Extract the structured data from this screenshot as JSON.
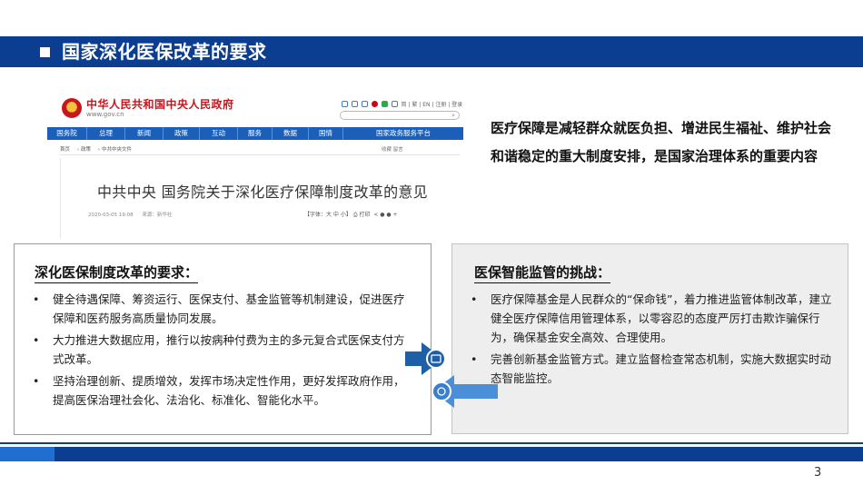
{
  "slide": {
    "title": "国家深化医保改革的要求",
    "page_number": "3"
  },
  "gov_site": {
    "logo_name": "中华人民共和国中央人民政府",
    "logo_url": "www.gov.cn",
    "utility_links": "简 | 繁 | EN | 注册 | 登录",
    "nav": [
      "国务院",
      "总理",
      "新闻",
      "政策",
      "互动",
      "服务",
      "数据",
      "国情",
      "国家政务服务平台"
    ],
    "breadcrumb": [
      "首页",
      "政策",
      "中共中央文件"
    ],
    "tools": "收藏   留言",
    "article_title": "中共中央 国务院关于深化医疗保障制度改革的意见",
    "date": "2020-03-05 19:08",
    "source": "来源：新华社",
    "font_size_control": "【字体：大 中 小】",
    "print_label": "打印"
  },
  "intro": {
    "text": "医疗保障是减轻群众就医负担、增进民生福祉、维护社会和谐稳定的重大制度安排，是国家治理体系的重要内容"
  },
  "left_box": {
    "heading": "深化医保制度改革的要求：",
    "bullets": [
      "健全待遇保障、筹资运行、医保支付、基金监管等机制建设，促进医疗保障和医药服务高质量协同发展。",
      "大力推进大数据应用，推行以按病种付费为主的多元复合式医保支付方式改革。",
      "坚持治理创新、提质增效，发挥市场决定性作用，更好发挥政府作用，提高医保治理社会化、法治化、标准化、智能化水平。"
    ]
  },
  "right_box": {
    "heading": "医保智能监管的挑战：",
    "bullets": [
      "医疗保障基金是人民群众的“保命钱”，着力推进监管体制改革，建立健全医疗保障信用管理体系，以零容忍的态度严厉打击欺诈骗保行为，确保基金安全高效、合理使用。",
      "完善创新基金监管方式。建立监督检查常态机制，实施大数据实时动态智能监控。"
    ]
  },
  "colors": {
    "title_bar": "#0b3d91",
    "gov_nav": "#1c5fb8",
    "gov_red": "#c8161d",
    "arrow_dark": "#1f5fa8",
    "arrow_light": "#4a8fd8"
  },
  "bullet_glyph": "•"
}
